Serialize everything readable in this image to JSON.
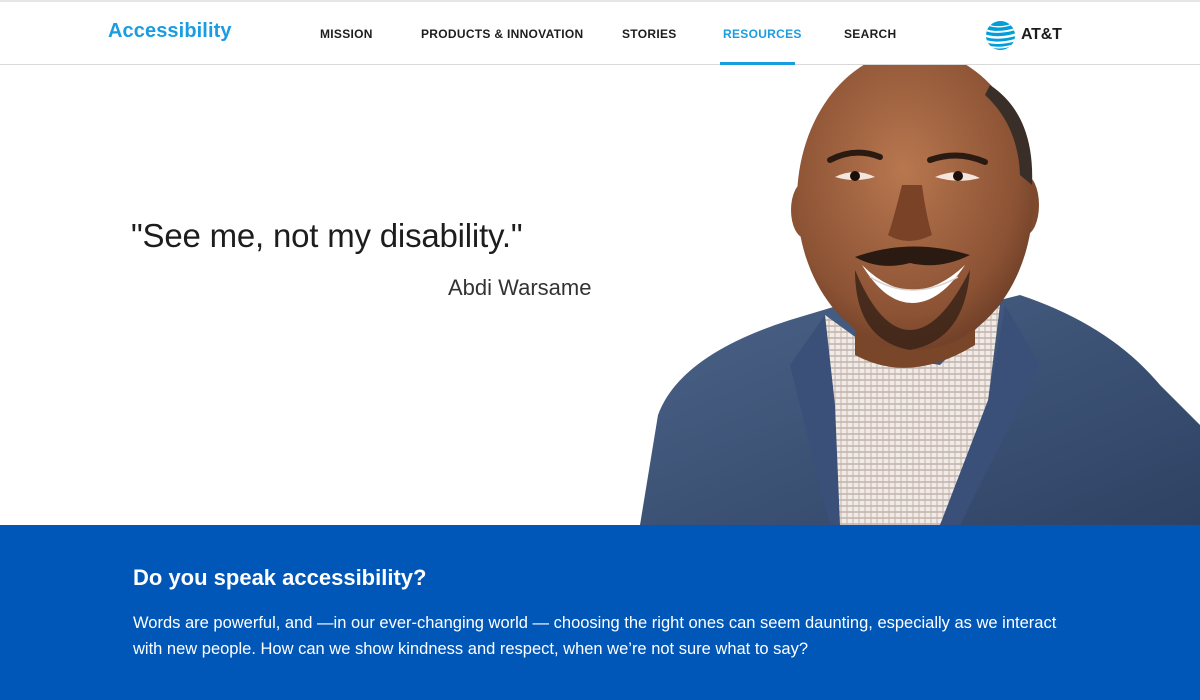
{
  "header": {
    "brand": "Accessibility",
    "nav": {
      "mission": "MISSION",
      "products": "PRODUCTS & INNOVATION",
      "stories": "STORIES",
      "resources": "RESOURCES",
      "search": "SEARCH"
    },
    "active_nav": "resources",
    "logo_text": "AT&T"
  },
  "hero": {
    "quote": "\"See me, not my disability.\"",
    "attribution": "Abdi Warsame"
  },
  "section": {
    "title": "Do you speak accessibility?",
    "body": "Words are powerful, and —in our ever-changing world — choosing the right ones can seem daunting, especially as we interact with new people. How can we show kindness and respect, when we’re not sure what to say?"
  },
  "colors": {
    "accent": "#1a9de0",
    "band": "#0057b8",
    "text": "#1d1d1d"
  },
  "icons": {
    "logo": "att-globe-icon"
  }
}
